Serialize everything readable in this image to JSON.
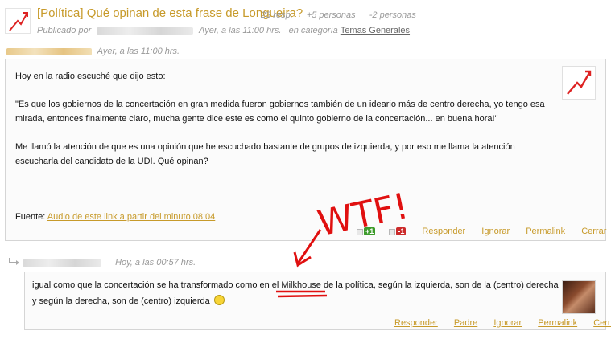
{
  "thread": {
    "title": "[Política] Qué opinan de esta frase de Longueira?",
    "responses": "23 resp.",
    "plus_people": "+5 personas",
    "minus_people": "-2 personas",
    "published_prefix": "Publicado por",
    "published_time": "Ayer, a las 11:00 hrs.",
    "category_prefix": "en categoría",
    "category": "Temas Generales"
  },
  "post": {
    "time": "Ayer, a las 11:00 hrs.",
    "paragraph_1": "Hoy en la radio escuché que dijo esto:",
    "paragraph_2": "\"Es que los gobiernos de la concertación en gran medida fueron gobiernos también de un ideario más de centro derecha, yo tengo esa mirada, entonces finalmente claro, mucha gente dice este es como el quinto gobierno de la concertación... en buena hora!\"",
    "paragraph_3": "Me llamó la atención de que es una opinión que he escuchado bastante de grupos de izquierda, y por eso me llama la atención escucharla del candidato de la UDI. Qué opinan?",
    "source_label": "Fuente:",
    "source_link": "Audio de este link a partir del minuto 08:04",
    "vote_plus": "+1",
    "vote_minus": "-1",
    "actions": {
      "reply": "Responder",
      "ignore": "Ignorar",
      "permalink": "Permalink",
      "close": "Cerrar"
    }
  },
  "reply": {
    "time": "Hoy, a las 00:57 hrs.",
    "text_before": "igual como que la concertación se ha transformado como en el ",
    "highlight": "Milkhouse",
    "text_after": " de la política, según la izquierda, son de la (centro) derecha y según la derecha, son de (centro) izquierda",
    "actions": {
      "reply": "Responder",
      "parent": "Padre",
      "ignore": "Ignorar",
      "permalink": "Permalink",
      "close": "Cerrar"
    }
  },
  "annotation": {
    "text": "WTF!",
    "color": "#e01010"
  },
  "colors": {
    "link": "#c79a2a",
    "meta": "#999999",
    "border": "#d5d5d5"
  }
}
